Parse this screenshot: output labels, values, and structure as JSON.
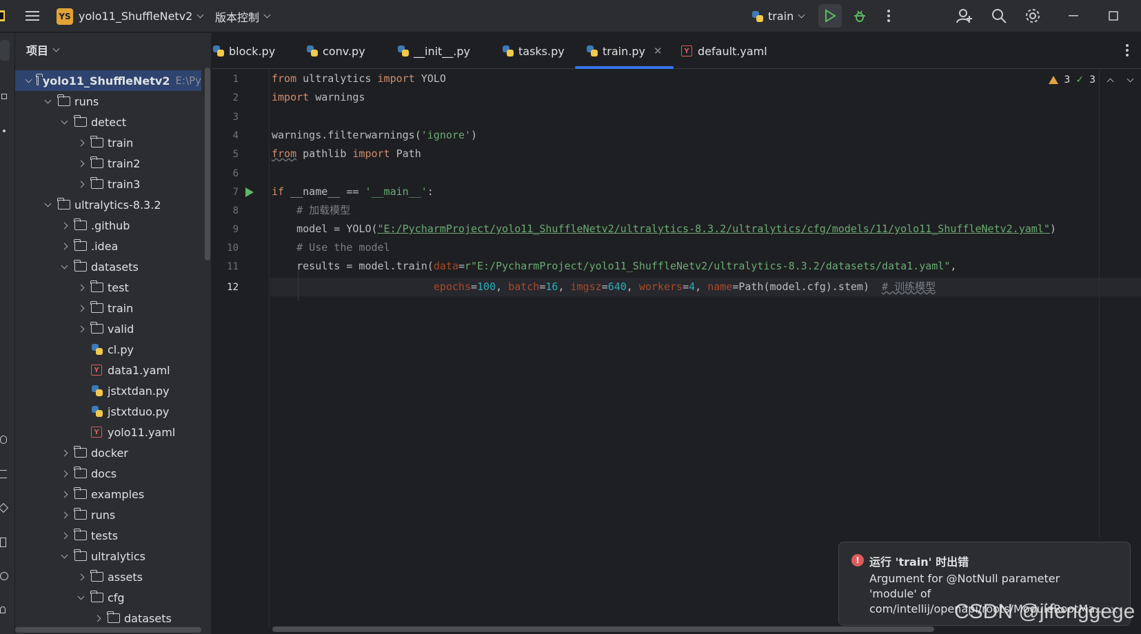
{
  "titlebar": {
    "project_badge": "YS",
    "project_name": "yolo11_ShuffleNetv2",
    "vcs_label": "版本控制",
    "run_config": "train"
  },
  "project_panel": {
    "header": "项目",
    "tree": [
      {
        "label": "yolo11_ShuffleNetv2",
        "sub": "E:\\Py",
        "type": "folder",
        "depth": 0,
        "open": true,
        "bold": true
      },
      {
        "label": "runs",
        "type": "folder",
        "depth": 1,
        "open": true
      },
      {
        "label": "detect",
        "type": "folder",
        "depth": 2,
        "open": true
      },
      {
        "label": "train",
        "type": "folder",
        "depth": 3,
        "open": false
      },
      {
        "label": "train2",
        "type": "folder",
        "depth": 3,
        "open": false
      },
      {
        "label": "train3",
        "type": "folder",
        "depth": 3,
        "open": false
      },
      {
        "label": "ultralytics-8.3.2",
        "type": "folder",
        "depth": 1,
        "open": true
      },
      {
        "label": ".github",
        "type": "folder",
        "depth": 2,
        "open": false
      },
      {
        "label": ".idea",
        "type": "folder",
        "depth": 2,
        "open": false
      },
      {
        "label": "datasets",
        "type": "folder",
        "depth": 2,
        "open": true
      },
      {
        "label": "test",
        "type": "folder",
        "depth": 3,
        "open": false
      },
      {
        "label": "train",
        "type": "folder",
        "depth": 3,
        "open": false
      },
      {
        "label": "valid",
        "type": "folder",
        "depth": 3,
        "open": false
      },
      {
        "label": "cl.py",
        "type": "py",
        "depth": 3
      },
      {
        "label": "data1.yaml",
        "type": "yaml",
        "depth": 3
      },
      {
        "label": "jstxtdan.py",
        "type": "py",
        "depth": 3
      },
      {
        "label": "jstxtduo.py",
        "type": "py",
        "depth": 3
      },
      {
        "label": "yolo11.yaml",
        "type": "yaml",
        "depth": 3
      },
      {
        "label": "docker",
        "type": "folder",
        "depth": 2,
        "open": false
      },
      {
        "label": "docs",
        "type": "folder",
        "depth": 2,
        "open": false
      },
      {
        "label": "examples",
        "type": "folder",
        "depth": 2,
        "open": false
      },
      {
        "label": "runs",
        "type": "folder",
        "depth": 2,
        "open": false
      },
      {
        "label": "tests",
        "type": "folder",
        "depth": 2,
        "open": false
      },
      {
        "label": "ultralytics",
        "type": "folder",
        "depth": 2,
        "open": true
      },
      {
        "label": "assets",
        "type": "folder",
        "depth": 3,
        "open": false
      },
      {
        "label": "cfg",
        "type": "folder",
        "depth": 3,
        "open": true
      },
      {
        "label": "datasets",
        "type": "folder",
        "depth": 4,
        "open": false
      }
    ]
  },
  "tabs": [
    {
      "label": "block.py",
      "type": "py"
    },
    {
      "label": "conv.py",
      "type": "py"
    },
    {
      "label": "__init__.py",
      "type": "py"
    },
    {
      "label": "tasks.py",
      "type": "py"
    },
    {
      "label": "train.py",
      "type": "py",
      "active": true
    },
    {
      "label": "default.yaml",
      "type": "yaml"
    }
  ],
  "editor": {
    "line_numbers": [
      "1",
      "2",
      "3",
      "4",
      "5",
      "6",
      "7",
      "8",
      "9",
      "10",
      "11",
      "12"
    ],
    "current_line": "12",
    "warnings": "3",
    "checks": "3"
  },
  "code": {
    "l1_a": "from",
    "l1_b": " ultralytics ",
    "l1_c": "import",
    "l1_d": " YOLO",
    "l2_a": "import",
    "l2_b": " warnings",
    "l4_a": "warnings.filterwarnings(",
    "l4_b": "'ignore'",
    "l4_c": ")",
    "l5_a": "from",
    "l5_b": " pathlib ",
    "l5_c": "import",
    "l5_d": " Path",
    "l7_a": "if",
    "l7_b": " __name__ == ",
    "l7_c": "'__main__'",
    "l7_d": ":",
    "l8": "    # 加载模型",
    "l9_a": "    model = YOLO(",
    "l9_b": "\"E:/PycharmProject/yolo11_ShuffleNetv2/ultralytics-8.3.2/ultralytics/cfg/models/11/yolo11_ShuffleNetv2.yaml\"",
    "l9_c": ")",
    "l10": "    # Use the model",
    "l11_a": "    results = model.train(",
    "l11_b": "data",
    "l11_c": "=",
    "l11_d": "r\"E:/PycharmProject/yolo11_ShuffleNetv2/ultralytics-8.3.2/datasets/data1.yaml\"",
    "l11_e": ",",
    "l12_pad": "                          ",
    "l12_a": "epochs",
    "l12_b": "=",
    "l12_c": "100",
    "l12_d": ", ",
    "l12_e": "batch",
    "l12_f": "=",
    "l12_g": "16",
    "l12_h": ", ",
    "l12_i": "imgsz",
    "l12_j": "=",
    "l12_k": "640",
    "l12_l": ", ",
    "l12_m": "workers",
    "l12_n": "=",
    "l12_o": "4",
    "l12_p": ", ",
    "l12_q": "name",
    "l12_r": "=Path(model.cfg).stem)  ",
    "l12_s": "# 训练模型"
  },
  "notification": {
    "title": "运行 'train' 时出错",
    "body": "Argument for @NotNull parameter 'module' of com/intellij/openapi/roots/ModuleRootMa...",
    "close": "✕"
  },
  "watermark": "CSDN @jifenggege",
  "colors": {
    "accent": "#3574f0",
    "error": "#db5c5c",
    "warning": "#e0a341",
    "run": "#5fb865"
  }
}
